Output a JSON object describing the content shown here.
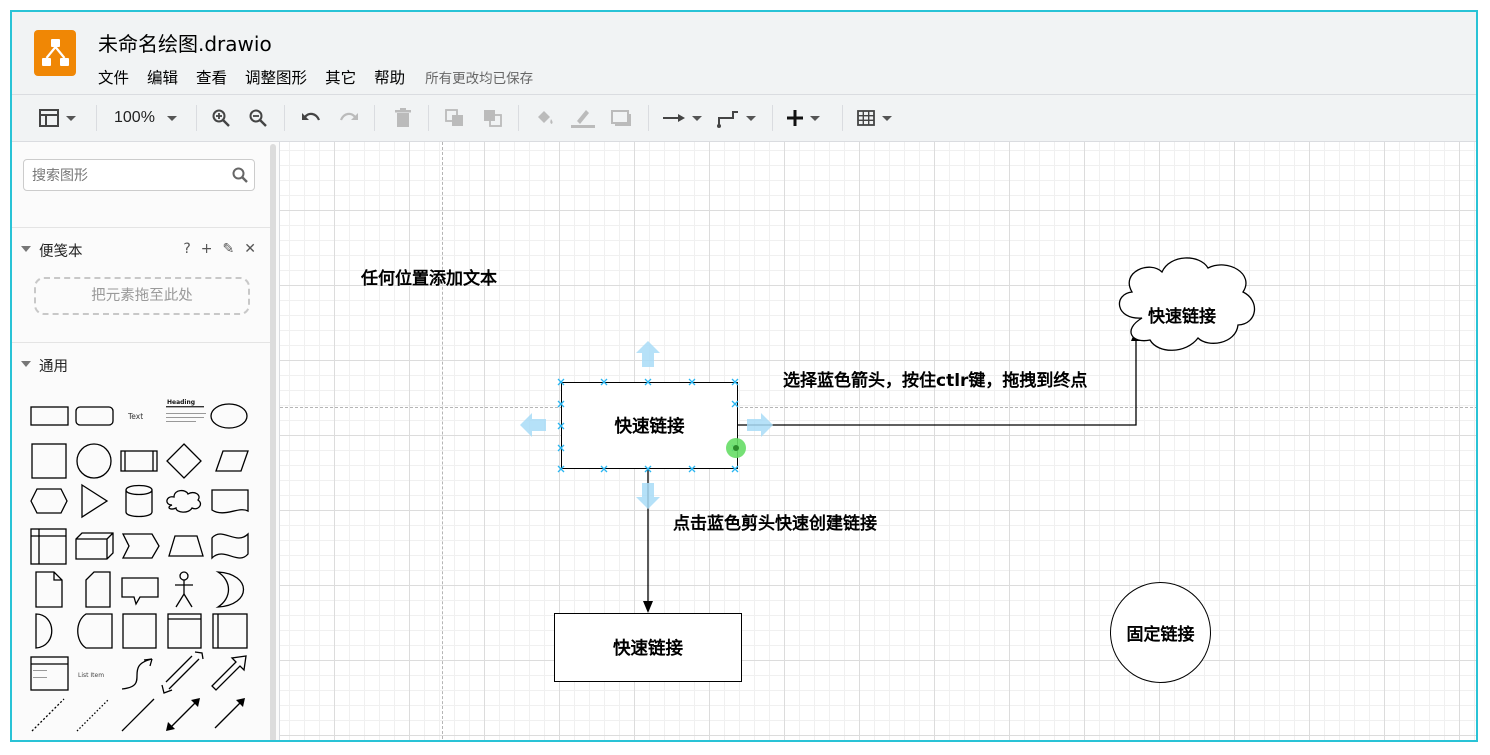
{
  "app": {
    "title": "未命名绘图.drawio",
    "brand_color": "#f08705",
    "window_border_color": "#29c3d6"
  },
  "menu": {
    "items": [
      "文件",
      "编辑",
      "查看",
      "调整图形",
      "其它",
      "帮助"
    ],
    "save_status": "所有更改均已保存"
  },
  "toolbar": {
    "zoom": "100%",
    "icons": [
      "format-panel-icon",
      "zoom-in-icon",
      "zoom-out-icon",
      "undo-icon",
      "redo-icon",
      "delete-icon",
      "to-front-icon",
      "to-back-icon",
      "fill-color-icon",
      "line-color-icon",
      "shadow-icon",
      "connection-arrow-icon",
      "waypoints-icon",
      "insert-plus-icon",
      "table-icon"
    ]
  },
  "sidebar": {
    "search_placeholder": "搜索图形",
    "scratchpad": {
      "title": "便笺本",
      "actions": [
        "?",
        "+",
        "✎",
        "✕"
      ],
      "drop_hint": "把元素拖至此处"
    },
    "general": {
      "title": "通用",
      "text_shape_label": "Text",
      "heading_shape_label": "Heading",
      "list_item_label": "List Item"
    }
  },
  "canvas": {
    "free_text": "任何位置添加文本",
    "source_node": "快速链接",
    "cloud_node": "快速链接",
    "target_node": "快速链接",
    "fixed_node": "固定链接",
    "hint_ctrl_drag": "选择蓝色箭头，按住ctlr键，拖拽到终点",
    "hint_click_arrow": "点击蓝色剪头快速创建链接",
    "selection_color": "#29b6f2",
    "hover_point_color": "#66dd66"
  }
}
